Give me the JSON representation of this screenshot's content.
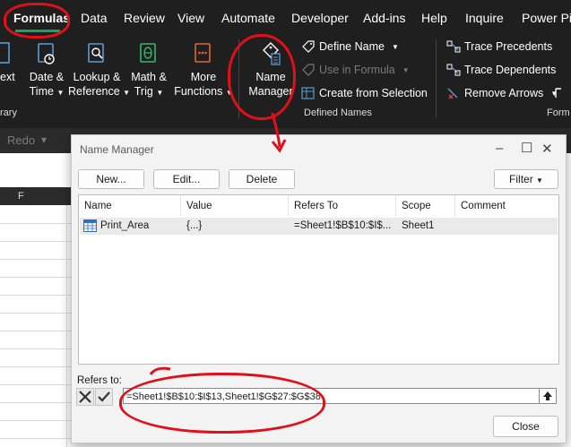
{
  "ribbon": {
    "tabs": [
      "Formulas",
      "Data",
      "Review",
      "View",
      "Automate",
      "Developer",
      "Add-ins",
      "Help",
      "Inquire",
      "Power Pi"
    ],
    "function_library": {
      "text_partial": "ext",
      "date_time": [
        "Date &",
        "Time"
      ],
      "lookup_ref": [
        "Lookup &",
        "Reference"
      ],
      "math_trig": [
        "Math &",
        "Trig"
      ],
      "more_functions": [
        "More",
        "Functions"
      ],
      "group_label_partial": "rary"
    },
    "defined_names": {
      "name_manager": [
        "Name",
        "Manager"
      ],
      "define_name": "Define Name",
      "use_in_formula": "Use in Formula",
      "create_from_selection": "Create from Selection",
      "group_label": "Defined Names"
    },
    "formula_auditing": {
      "trace_precedents": "Trace Precedents",
      "trace_dependents": "Trace Dependents",
      "remove_arrows": "Remove Arrows",
      "group_label_partial": "Form"
    },
    "redo": "Redo",
    "column_f": "F"
  },
  "dialog": {
    "title": "Name Manager",
    "buttons": {
      "new": "New...",
      "edit": "Edit...",
      "delete": "Delete",
      "filter": "Filter",
      "close": "Close"
    },
    "columns": [
      "Name",
      "Value",
      "Refers To",
      "Scope",
      "Comment"
    ],
    "rows": [
      {
        "name": "Print_Area",
        "value": "{...}",
        "refers_to": "=Sheet1!$B$10:$I$...",
        "scope": "Sheet1",
        "comment": ""
      }
    ],
    "refers_to_label": "Refers to:",
    "refers_to_value": "=Sheet1!$B$10:$I$13,Sheet1!$G$27:$G$38"
  },
  "colors": {
    "ribbon_bg": "#1f1f1f",
    "accent": "#1aa260",
    "annotation": "#e0101a"
  }
}
